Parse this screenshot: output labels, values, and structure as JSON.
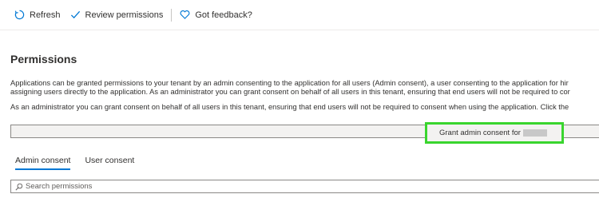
{
  "toolbar": {
    "refresh_label": "Refresh",
    "review_label": "Review permissions",
    "feedback_label": "Got feedback?"
  },
  "permissions": {
    "title": "Permissions",
    "description_line1": "Applications can be granted permissions to your tenant by an admin consenting to the application for all users (Admin consent), a user consenting to the application for hir",
    "description_line2": "assigning users directly to the application. As an administrator you can grant consent on behalf of all users in this tenant, ensuring that end users will not be required to cor",
    "admin_note": "As an administrator you can grant consent on behalf of all users in this tenant, ensuring that end users will not be required to consent when using the application. Click the",
    "grant_button_label": "Grant admin consent for"
  },
  "tabs": [
    {
      "label": "Admin consent",
      "active": true
    },
    {
      "label": "User consent",
      "active": false
    }
  ],
  "search": {
    "placeholder": "Search permissions",
    "value": ""
  },
  "colors": {
    "accent": "#0078d4",
    "highlight": "#39d52e",
    "icon": "#0078d4"
  }
}
